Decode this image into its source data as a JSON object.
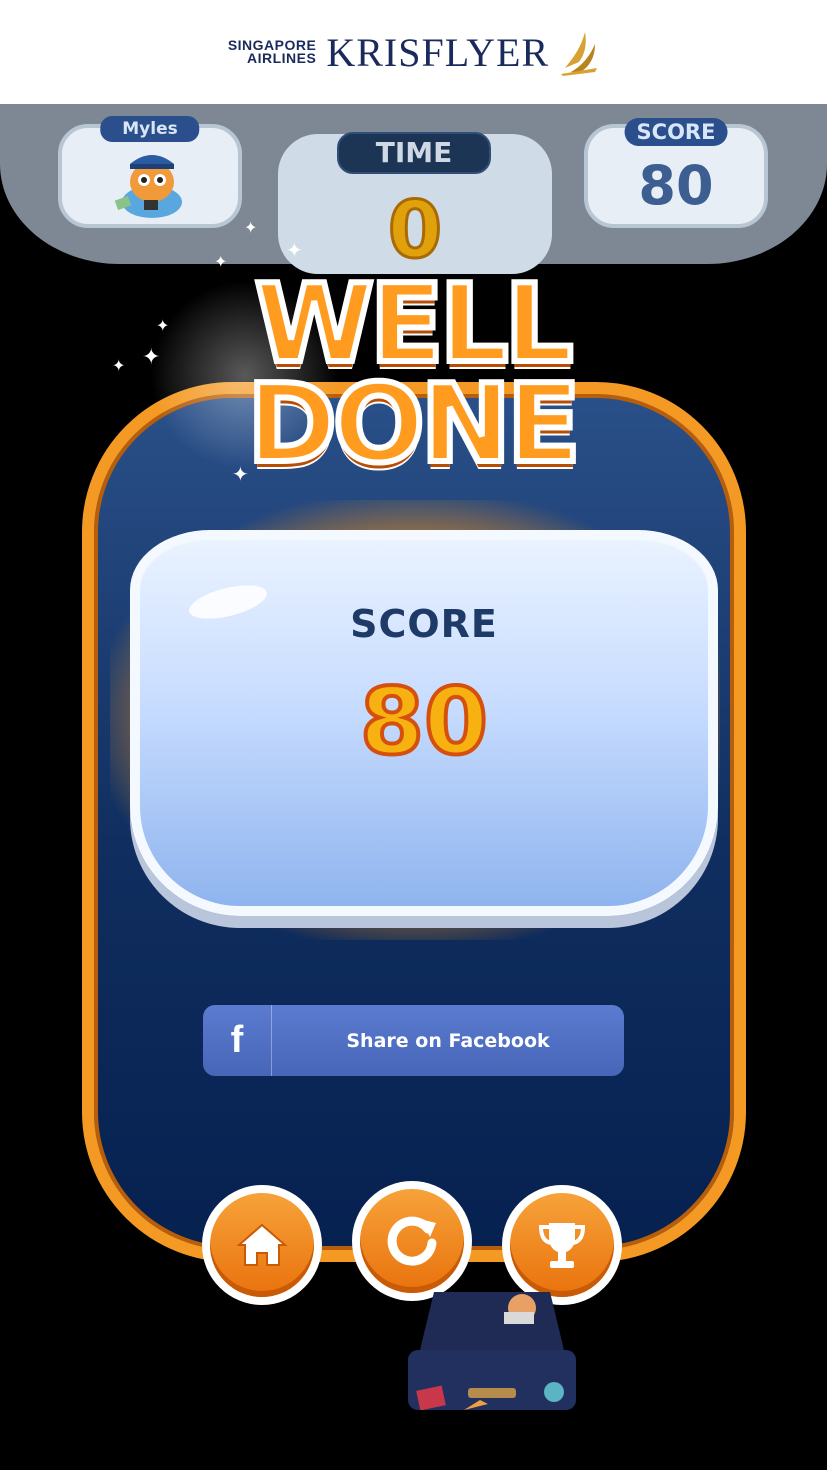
{
  "header": {
    "brand_line1": "SINGAPORE",
    "brand_line2": "AIRLINES",
    "brand_name": "KRISFLYER"
  },
  "hud": {
    "player_label": "Myles",
    "time_label": "TIME",
    "time_value": "0",
    "score_label": "SCORE",
    "score_value": "80"
  },
  "result": {
    "title_line1": "WELL",
    "title_line2": "DONE",
    "score_label": "SCORE",
    "score_value": "80"
  },
  "share": {
    "facebook_icon": "f",
    "facebook_label": "Share on Facebook"
  },
  "actions": {
    "home_icon": "home-icon",
    "replay_icon": "replay-icon",
    "leaderboard_icon": "trophy-icon"
  },
  "colors": {
    "accent_orange": "#f49a24",
    "panel_blue": "#0f2d5e",
    "facebook_blue": "#4766b8",
    "score_gold": "#f7b211"
  }
}
